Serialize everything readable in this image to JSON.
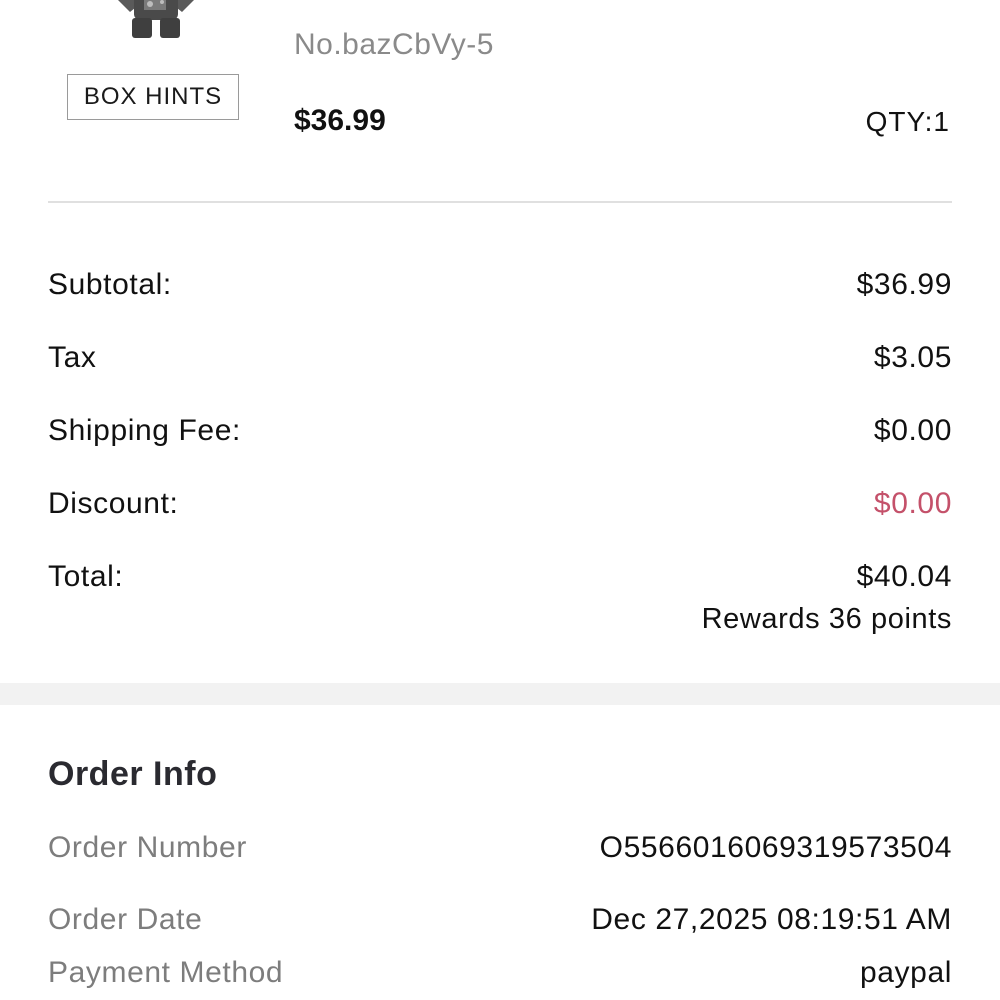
{
  "product": {
    "image_icon": "product-figure-image",
    "sku": "No.bazCbVy-5",
    "box_hints_label": "BOX HINTS",
    "price": "$36.99",
    "qty": "QTY:1"
  },
  "summary": {
    "rows": [
      {
        "label": "Subtotal:",
        "value": "$36.99"
      },
      {
        "label": "Tax",
        "value": "$3.05"
      },
      {
        "label": "Shipping Fee:",
        "value": "$0.00"
      },
      {
        "label": "Discount:",
        "value": "$0.00"
      },
      {
        "label": "Total:",
        "value": "$40.04"
      }
    ],
    "rewards": "Rewards 36 points"
  },
  "order_info": {
    "title": "Order Info",
    "rows": [
      {
        "label": "Order Number",
        "value": "O556601606931957350​4"
      },
      {
        "label": "Order Date",
        "value": "Dec 27,2025 08:19:51 AM"
      },
      {
        "label": "Payment Method",
        "value": "paypal"
      }
    ]
  },
  "colors": {
    "discount": "#c4516a",
    "muted_label": "#7d7d7d",
    "band": "#f2f2f2"
  }
}
